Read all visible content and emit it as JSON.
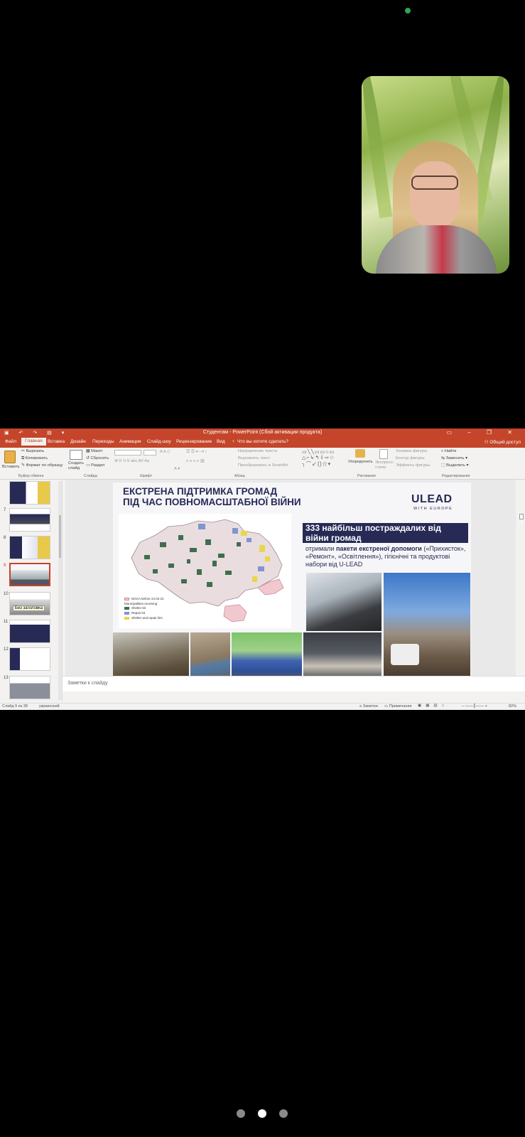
{
  "app": {
    "window_title": "Студентам - PowerPoint (Сбой активации продукта)",
    "menu_tabs": [
      "Файл",
      "Главная",
      "Вставка",
      "Дизайн",
      "Переходы",
      "Анимация",
      "Слайд-шоу",
      "Рецензирование",
      "Вид"
    ],
    "active_tab": "Главная",
    "tell_me": "Что вы хотите сделать?",
    "share": "Общий доступ"
  },
  "ribbon": {
    "paste": "Вставить",
    "cut": "Вырезать",
    "copy": "Копировать",
    "format_painter": "Формат по образцу",
    "clipboard_group": "Буфер обмена",
    "new_slide": "Создать слайд",
    "layout": "Макет",
    "reset": "Сбросить",
    "section": "Раздел",
    "slides_group": "Слайды",
    "font_group": "Шрифт",
    "text_direction": "Направление текста",
    "align_text": "Выровнять текст",
    "smartart": "Преобразовать в SmartArt",
    "paragraph_group": "Абзац",
    "arrange": "Упорядочить",
    "quick_styles": "Экспресс-стили",
    "shape_fill": "Заливка фигуры",
    "shape_outline": "Контур фигуры",
    "shape_effects": "Эффекты фигуры",
    "drawing_group": "Рисование",
    "find": "Найти",
    "replace": "Заменить",
    "select": "Выделить",
    "editing_group": "Редактирование"
  },
  "thumbnails": [
    {
      "num": "",
      "active": false
    },
    {
      "num": "7",
      "active": false
    },
    {
      "num": "8",
      "active": false
    },
    {
      "num": "9",
      "active": true
    },
    {
      "num": "10",
      "active": false
    },
    {
      "num": "11",
      "active": false
    },
    {
      "num": "12",
      "active": false
    },
    {
      "num": "13",
      "active": false
    }
  ],
  "thumb_tooltip": "Без заголовка",
  "slide": {
    "title_line1": "ЕКСТРЕНА ПІДТРИМКА ГРОМАД",
    "title_line2": "ПІД ЧАС ПОВНОМАСШТАБНОЇ ВІЙНИ",
    "logo": "ULEAD",
    "logo_sub": "WITH EUROPE",
    "headline": "333 найбільш постраждалих від війни громад",
    "desc_part1": "отримали ",
    "desc_bold": "пакети екстреної допомоги",
    "desc_part2": " («Прихисток», «Ремонт», «Освітлення»), гігієнічні та продуктові набори від U-LEAD",
    "legend": {
      "ngca": "NGCA before 24.02.22",
      "receiving": "Municipalities receiving",
      "shelter": "Shelter kit",
      "repair": "Repair kit",
      "both": "Shelter and repair kits"
    },
    "colors": {
      "navy": "#262a55",
      "shelter": "#3f6e4f",
      "repair": "#7f96cc",
      "both": "#e6d84a",
      "ngca": "#f2c8cf"
    }
  },
  "notes_placeholder": "Заметки к слайду",
  "status": {
    "slide_info": "Слайд 9 из 38",
    "language": "украинский",
    "notes": "Заметки",
    "comments": "Примечания",
    "zoom": "82%"
  },
  "pager": {
    "count": 3,
    "active": 1
  }
}
